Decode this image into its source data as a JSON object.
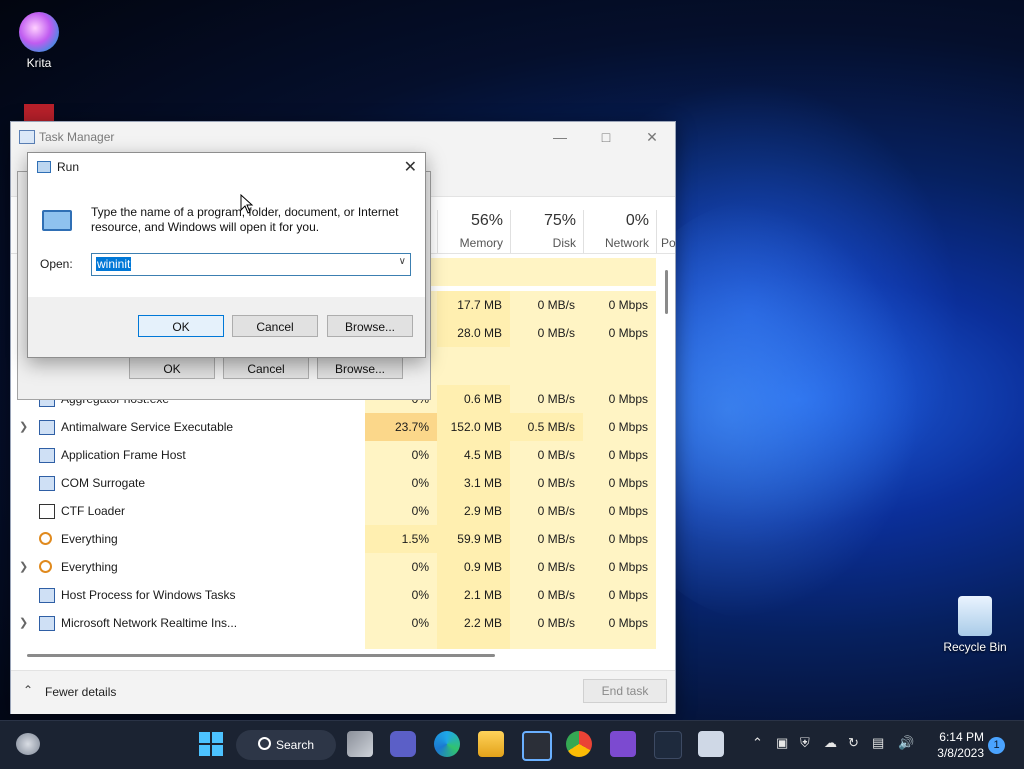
{
  "desktop": {
    "icons": [
      {
        "label": "Krita"
      },
      {
        "label": "Recycle Bin"
      }
    ]
  },
  "task_manager": {
    "title": "Task Manager",
    "columns": [
      {
        "pct": "56%",
        "name": "Memory"
      },
      {
        "pct": "75%",
        "name": "Disk"
      },
      {
        "pct": "0%",
        "name": "Network"
      },
      {
        "pct": "",
        "name": "Po"
      }
    ],
    "rows": [
      {
        "name": "",
        "expand": false,
        "cpu": "",
        "mem": "17.7 MB",
        "disk": "0 MB/s",
        "net": "0 Mbps",
        "icon": "app-icon"
      },
      {
        "name": "",
        "expand": false,
        "cpu": "",
        "mem": "28.0 MB",
        "disk": "0 MB/s",
        "net": "0 Mbps",
        "icon": "app-icon"
      },
      {
        "name": "Aggregator host.exe",
        "expand": false,
        "cpu": "0%",
        "mem": "0.6 MB",
        "disk": "0 MB/s",
        "net": "0 Mbps",
        "icon": "app-icon"
      },
      {
        "name": "Antimalware Service Executable",
        "expand": true,
        "cpu": "23.7%",
        "mem": "152.0 MB",
        "disk": "0.5 MB/s",
        "net": "0 Mbps",
        "icon": "app-icon"
      },
      {
        "name": "Application Frame Host",
        "expand": false,
        "cpu": "0%",
        "mem": "4.5 MB",
        "disk": "0 MB/s",
        "net": "0 Mbps",
        "icon": "app-icon"
      },
      {
        "name": "COM Surrogate",
        "expand": false,
        "cpu": "0%",
        "mem": "3.1 MB",
        "disk": "0 MB/s",
        "net": "0 Mbps",
        "icon": "app-icon"
      },
      {
        "name": "CTF Loader",
        "expand": false,
        "cpu": "0%",
        "mem": "2.9 MB",
        "disk": "0 MB/s",
        "net": "0 Mbps",
        "icon": "ctf-icon"
      },
      {
        "name": "Everything",
        "expand": false,
        "cpu": "1.5%",
        "mem": "59.9 MB",
        "disk": "0 MB/s",
        "net": "0 Mbps",
        "icon": "everything-icon"
      },
      {
        "name": "Everything",
        "expand": true,
        "cpu": "0%",
        "mem": "0.9 MB",
        "disk": "0 MB/s",
        "net": "0 Mbps",
        "icon": "everything-icon"
      },
      {
        "name": "Host Process for Windows Tasks",
        "expand": false,
        "cpu": "0%",
        "mem": "2.1 MB",
        "disk": "0 MB/s",
        "net": "0 Mbps",
        "icon": "app-icon"
      },
      {
        "name": "Microsoft Network Realtime Ins...",
        "expand": true,
        "cpu": "0%",
        "mem": "2.2 MB",
        "disk": "0 MB/s",
        "net": "0 Mbps",
        "icon": "app-icon"
      }
    ],
    "footer": {
      "fewer_details": "Fewer details",
      "end_task": "End task"
    }
  },
  "ghost_dialog": {
    "ok": "OK",
    "cancel": "Cancel",
    "browse": "Browse..."
  },
  "run_dialog": {
    "title": "Run",
    "description": "Type the name of a program, folder, document, or Internet resource, and Windows will open it for you.",
    "open_label": "Open:",
    "open_value": "wininit",
    "ok": "OK",
    "cancel": "Cancel",
    "browse": "Browse..."
  },
  "taskbar": {
    "search_label": "Search",
    "time": "6:14 PM",
    "date": "3/8/2023",
    "notification_count": "1"
  }
}
